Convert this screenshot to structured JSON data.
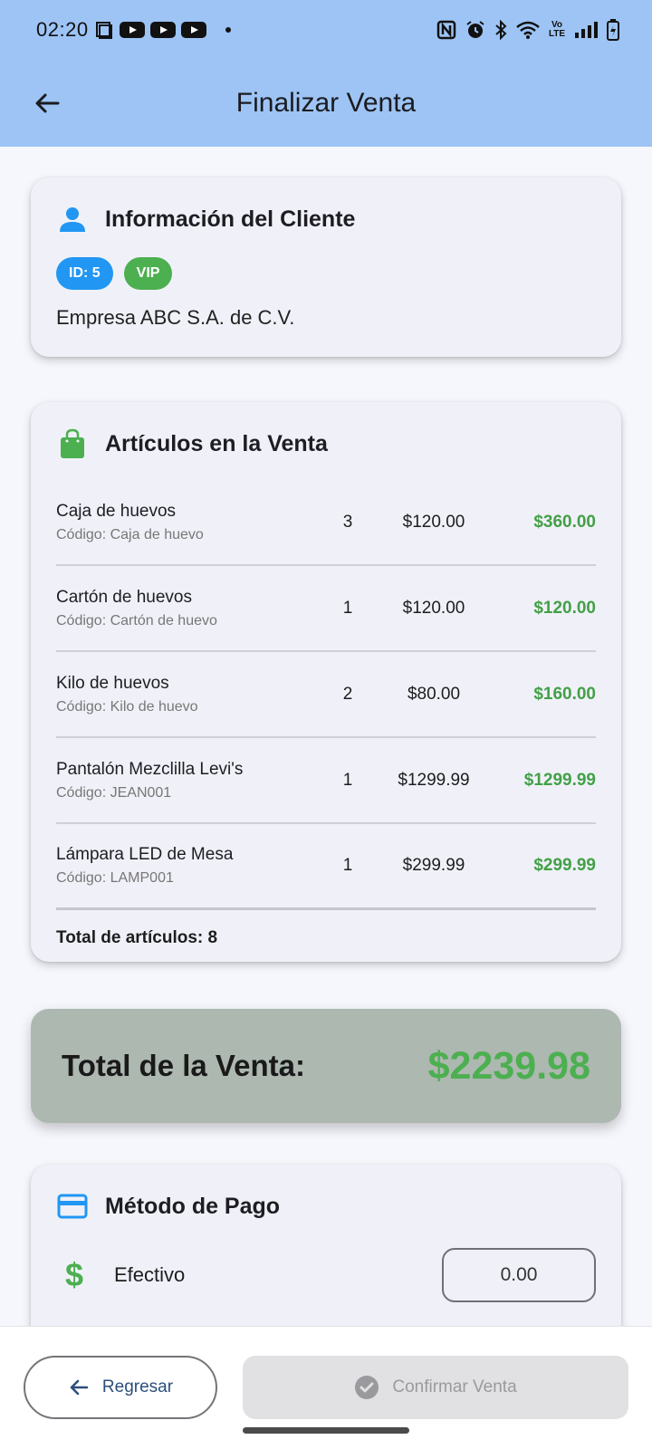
{
  "status": {
    "time": "02:20",
    "icons": [
      "screenshot-icon",
      "youtube-icon",
      "youtube-icon",
      "youtube-icon",
      "dot-icon",
      "nfc-icon",
      "alarm-icon",
      "bluetooth-icon",
      "wifi-icon",
      "volte-icon",
      "signal-icon",
      "battery-icon"
    ],
    "volte": "Vo LTE"
  },
  "appbar": {
    "title": "Finalizar Venta"
  },
  "client": {
    "title": "Información del Cliente",
    "id_chip": "ID: 5",
    "vip_chip": "VIP",
    "name": "Empresa ABC S.A. de C.V."
  },
  "items": {
    "title": "Artículos en la Venta",
    "list": [
      {
        "name": "Caja de huevos",
        "code": "Código: Caja de huevo",
        "qty": "3",
        "price": "$120.00",
        "subtotal": "$360.00"
      },
      {
        "name": "Cartón de huevos",
        "code": "Código: Cartón de huevo",
        "qty": "1",
        "price": "$120.00",
        "subtotal": "$120.00"
      },
      {
        "name": "Kilo de huevos",
        "code": "Código: Kilo de huevo",
        "qty": "2",
        "price": "$80.00",
        "subtotal": "$160.00"
      },
      {
        "name": "Pantalón Mezclilla Levi's",
        "code": "Código: JEAN001",
        "qty": "1",
        "price": "$1299.99",
        "subtotal": "$1299.99"
      },
      {
        "name": "Lámpara LED de Mesa",
        "code": "Código: LAMP001",
        "qty": "1",
        "price": "$299.99",
        "subtotal": "$299.99"
      }
    ],
    "total_count": "Total de artículos: 8"
  },
  "total": {
    "label": "Total de la Venta:",
    "value": "$2239.98"
  },
  "payment": {
    "title": "Método de Pago",
    "cash_label": "Efectivo",
    "cash_value": "0.00"
  },
  "buttons": {
    "back": "Regresar",
    "confirm": "Confirmar Venta"
  },
  "colors": {
    "accent": "#9dc4f5",
    "green": "#4caf50",
    "blue": "#2196f3"
  }
}
